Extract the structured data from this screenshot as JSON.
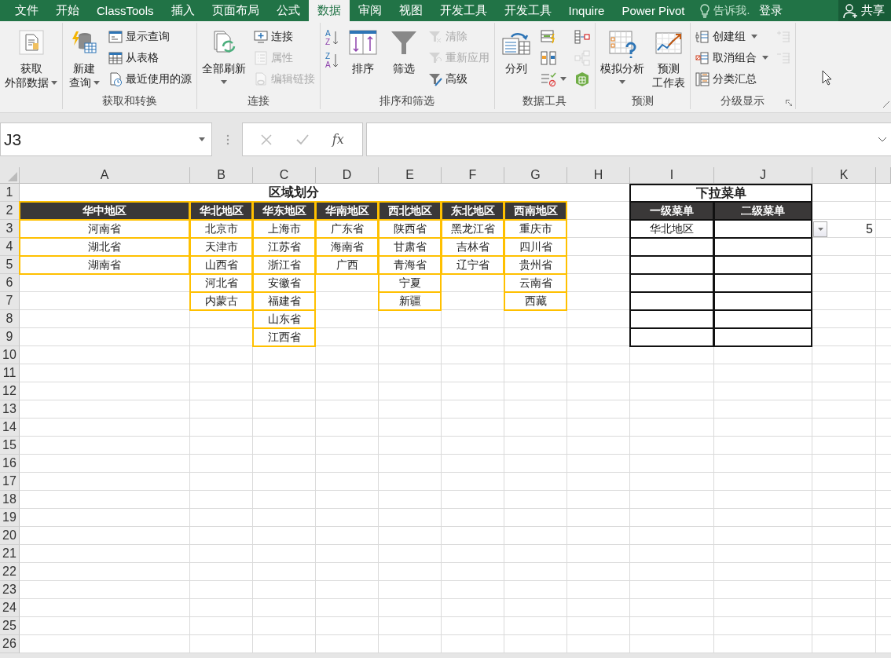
{
  "tabs": [
    {
      "label": "文件",
      "selected": false
    },
    {
      "label": "开始",
      "selected": false
    },
    {
      "label": "ClassTools",
      "selected": false
    },
    {
      "label": "插入",
      "selected": false
    },
    {
      "label": "页面布局",
      "selected": false
    },
    {
      "label": "公式",
      "selected": false
    },
    {
      "label": "数据",
      "selected": true
    },
    {
      "label": "审阅",
      "selected": false
    },
    {
      "label": "视图",
      "selected": false
    },
    {
      "label": "开发工具",
      "selected": false
    },
    {
      "label": "开发工具",
      "selected": false
    },
    {
      "label": "Inquire",
      "selected": false
    },
    {
      "label": "Power Pivot",
      "selected": false
    }
  ],
  "tell_me": "告诉我.",
  "sign_in": "登录",
  "share": "共享",
  "ribbon": {
    "groups": [
      {
        "columns": [
          [
            {
              "kind": "large",
              "lines": [
                "获取",
                "外部数据"
              ],
              "dropdown": true,
              "disabled": false
            }
          ]
        ]
      },
      {
        "label": "获取和转换",
        "columns": [
          [
            {
              "kind": "large",
              "lines": [
                "新建",
                "查询"
              ],
              "dropdown": true,
              "disabled": false
            }
          ],
          [
            {
              "kind": "small",
              "label": "显示查询",
              "dropdown": false,
              "disabled": false
            },
            {
              "kind": "small",
              "label": "从表格",
              "dropdown": false,
              "disabled": false
            },
            {
              "kind": "small",
              "label": "最近使用的源",
              "dropdown": false,
              "disabled": false
            }
          ]
        ]
      },
      {
        "label": "连接",
        "columns": [
          [
            {
              "kind": "large",
              "lines": [
                "全部刷新"
              ],
              "dropdown": true,
              "disabled": false
            }
          ],
          [
            {
              "kind": "small",
              "label": "连接",
              "dropdown": false,
              "disabled": false
            },
            {
              "kind": "small",
              "label": "属性",
              "dropdown": false,
              "disabled": true
            },
            {
              "kind": "small",
              "label": "编辑链接",
              "dropdown": false,
              "disabled": true
            }
          ]
        ]
      },
      {
        "label": "排序和筛选",
        "columns": [
          [
            {
              "kind": "sort",
              "glyphs": [
                "A",
                "Z"
              ],
              "dropdown": false,
              "disabled": false
            },
            {
              "kind": "sort",
              "glyphs": [
                "Z",
                "A"
              ],
              "dropdown": false,
              "disabled": false
            }
          ],
          [
            {
              "kind": "large",
              "lines": [
                "排序"
              ],
              "dropdown": false,
              "disabled": false
            }
          ],
          [
            {
              "kind": "large",
              "lines": [
                "筛选"
              ],
              "dropdown": false,
              "disabled": false
            }
          ],
          [
            {
              "kind": "small",
              "label": "清除",
              "dropdown": false,
              "disabled": true
            },
            {
              "kind": "small",
              "label": "重新应用",
              "dropdown": false,
              "disabled": true
            },
            {
              "kind": "small",
              "label": "高级",
              "dropdown": false,
              "disabled": false
            }
          ]
        ]
      },
      {
        "label": "数据工具",
        "columns": [
          [
            {
              "kind": "large",
              "lines": [
                "分列"
              ],
              "dropdown": false,
              "disabled": false
            }
          ],
          [
            {
              "kind": "icon",
              "dropdown": false,
              "disabled": false
            },
            {
              "kind": "icon",
              "dropdown": false,
              "disabled": false
            },
            {
              "kind": "icon",
              "dropdown": true,
              "disabled": false
            }
          ],
          [
            {
              "kind": "icon",
              "dropdown": false,
              "disabled": false
            },
            {
              "kind": "icon",
              "dropdown": false,
              "disabled": true
            },
            {
              "kind": "icon",
              "dropdown": false,
              "disabled": false
            }
          ]
        ]
      },
      {
        "label": "预测",
        "columns": [
          [
            {
              "kind": "large",
              "lines": [
                "模拟分析"
              ],
              "dropdown": true,
              "disabled": false
            }
          ],
          [
            {
              "kind": "large",
              "lines": [
                "预测",
                "工作表"
              ],
              "dropdown": false,
              "disabled": false
            }
          ]
        ]
      },
      {
        "label": "分级显示",
        "launcher": true,
        "columns": [
          [
            {
              "kind": "small",
              "label": "创建组",
              "dropdown": true,
              "disabled": false
            },
            {
              "kind": "small",
              "label": "取消组合",
              "dropdown": true,
              "disabled": false
            },
            {
              "kind": "small",
              "label": "分类汇总",
              "dropdown": false,
              "disabled": false
            }
          ],
          [
            {
              "kind": "icon",
              "dropdown": false,
              "disabled": true
            },
            {
              "kind": "icon",
              "dropdown": false,
              "disabled": true
            }
          ]
        ]
      }
    ]
  },
  "formula_bar": {
    "name_box": "J3",
    "function_label": "fx"
  },
  "sheet": {
    "columns": [
      "A",
      "B",
      "C",
      "D",
      "E",
      "F",
      "G",
      "H",
      "I",
      "J",
      "K"
    ],
    "rows": [
      "1",
      "2",
      "3",
      "4",
      "5",
      "6",
      "7",
      "8",
      "9",
      "10",
      "11",
      "12",
      "13",
      "14",
      "15",
      "16",
      "17",
      "18",
      "19",
      "20",
      "21",
      "22",
      "23",
      "24",
      "25",
      "26"
    ],
    "region_table": {
      "title": "区域划分",
      "columns": [
        {
          "header": "华中地区",
          "items": [
            "河南省",
            "湖北省",
            "湖南省"
          ]
        },
        {
          "header": "华北地区",
          "items": [
            "北京市",
            "天津市",
            "山西省",
            "河北省",
            "内蒙古"
          ]
        },
        {
          "header": "华东地区",
          "items": [
            "上海市",
            "江苏省",
            "浙江省",
            "安徽省",
            "福建省",
            "山东省",
            "江西省"
          ]
        },
        {
          "header": "华南地区",
          "items": [
            "广东省",
            "海南省",
            "广西"
          ]
        },
        {
          "header": "西北地区",
          "items": [
            "陕西省",
            "甘肃省",
            "青海省",
            "宁夏",
            "新疆"
          ]
        },
        {
          "header": "东北地区",
          "items": [
            "黑龙江省",
            "吉林省",
            "辽宁省"
          ]
        },
        {
          "header": "西南地区",
          "items": [
            "重庆市",
            "四川省",
            "贵州省",
            "云南省",
            "西藏"
          ]
        }
      ]
    },
    "menu_table": {
      "title": "下拉菜单",
      "headers": [
        "一级菜单",
        "二级菜单"
      ],
      "rows": [
        {
          "first": "华北地区",
          "validation_dropdown": true,
          "side_value": "5"
        },
        {
          "validation_dropdown": false
        },
        {
          "validation_dropdown": false
        },
        {
          "validation_dropdown": false
        },
        {
          "validation_dropdown": false
        },
        {
          "validation_dropdown": false
        },
        {
          "validation_dropdown": false
        }
      ]
    }
  }
}
